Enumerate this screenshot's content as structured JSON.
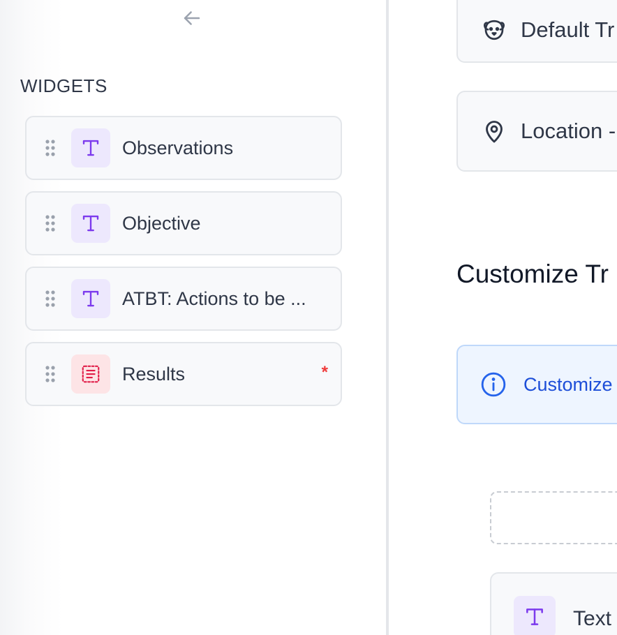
{
  "left_panel": {
    "back_icon": "arrow-left-icon",
    "heading": "WIDGETS",
    "widgets": [
      {
        "label": "Observations",
        "icon": "text-type-icon",
        "required": false
      },
      {
        "label": "Objective",
        "icon": "text-type-icon",
        "required": false
      },
      {
        "label": "ATBT: Actions to be ...",
        "icon": "text-type-icon",
        "required": false
      },
      {
        "label": "Results",
        "icon": "result-list-icon",
        "required": true,
        "required_mark": "*"
      }
    ]
  },
  "right_panel": {
    "fields": [
      {
        "label": "Default Tr",
        "icon": "pet-face-icon"
      },
      {
        "label": "Location -",
        "icon": "location-pin-icon"
      }
    ],
    "section_title": "Customize Tr",
    "info_banner": {
      "text": "Customize",
      "icon": "info-icon"
    },
    "text_widget": {
      "label": "Text",
      "icon": "text-type-icon"
    }
  },
  "colors": {
    "text_icon_bg": "#ede8fd",
    "text_icon_fg": "#7c3aed",
    "result_icon_bg": "#fde4e6",
    "result_icon_fg": "#e11d48",
    "info_bg": "#eef5ff",
    "info_fg": "#1d4ed8",
    "required": "#ef3b3b"
  }
}
